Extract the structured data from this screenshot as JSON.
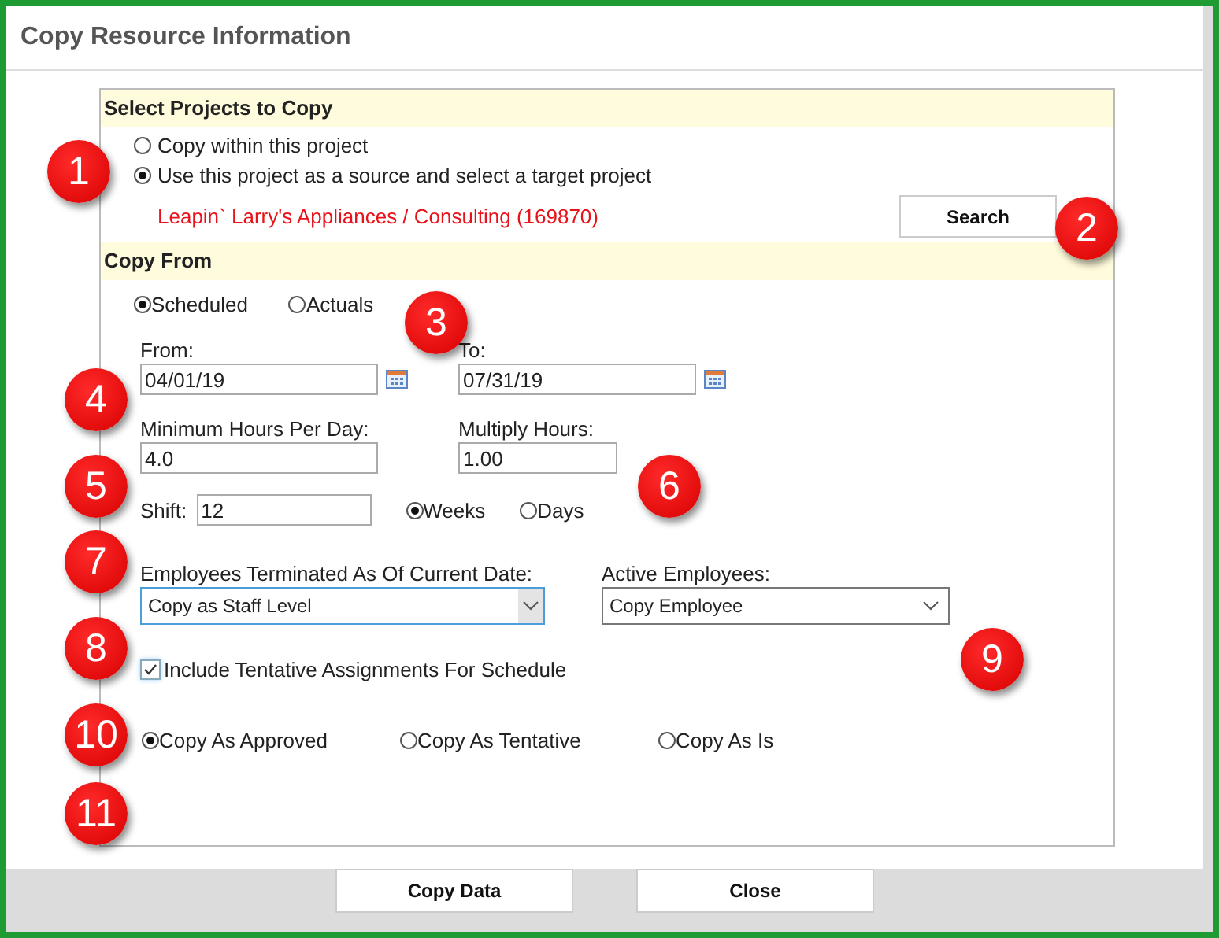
{
  "window": {
    "title": "Copy Resource Information"
  },
  "select_projects": {
    "heading": "Select Projects to Copy",
    "options": [
      {
        "label": "Copy within this project",
        "selected": false
      },
      {
        "label": "Use this project as a source and select a target project",
        "selected": true
      }
    ],
    "target_project": "Leapin` Larry's Appliances / Consulting (169870)",
    "search_button": "Search"
  },
  "copy_from": {
    "heading": "Copy From",
    "sources": [
      {
        "label": "Scheduled",
        "selected": true
      },
      {
        "label": "Actuals",
        "selected": false
      }
    ],
    "from": {
      "label": "From:",
      "value": "04/01/19"
    },
    "to": {
      "label": "To:",
      "value": "07/31/19"
    },
    "min_hours": {
      "label": "Minimum Hours Per Day:",
      "value": "4.0"
    },
    "multiply_hours": {
      "label": "Multiply Hours:",
      "value": "1.00"
    },
    "shift": {
      "label": "Shift:",
      "value": "12",
      "units": [
        {
          "label": "Weeks",
          "selected": true
        },
        {
          "label": "Days",
          "selected": false
        }
      ]
    },
    "terminated": {
      "label": "Employees Terminated As Of Current Date:",
      "value": "Copy as Staff Level"
    },
    "active": {
      "label": "Active Employees:",
      "value": "Copy Employee"
    },
    "tentative": {
      "label": "Include Tentative Assignments For Schedule",
      "checked": true
    },
    "copy_as": [
      {
        "label": "Copy As Approved",
        "selected": true
      },
      {
        "label": "Copy As Tentative",
        "selected": false
      },
      {
        "label": "Copy As Is",
        "selected": false
      }
    ]
  },
  "buttons": [
    "Copy Data",
    "Close"
  ],
  "callouts": [
    "1",
    "2",
    "3",
    "4",
    "5",
    "6",
    "7",
    "8",
    "9",
    "10",
    "11"
  ]
}
